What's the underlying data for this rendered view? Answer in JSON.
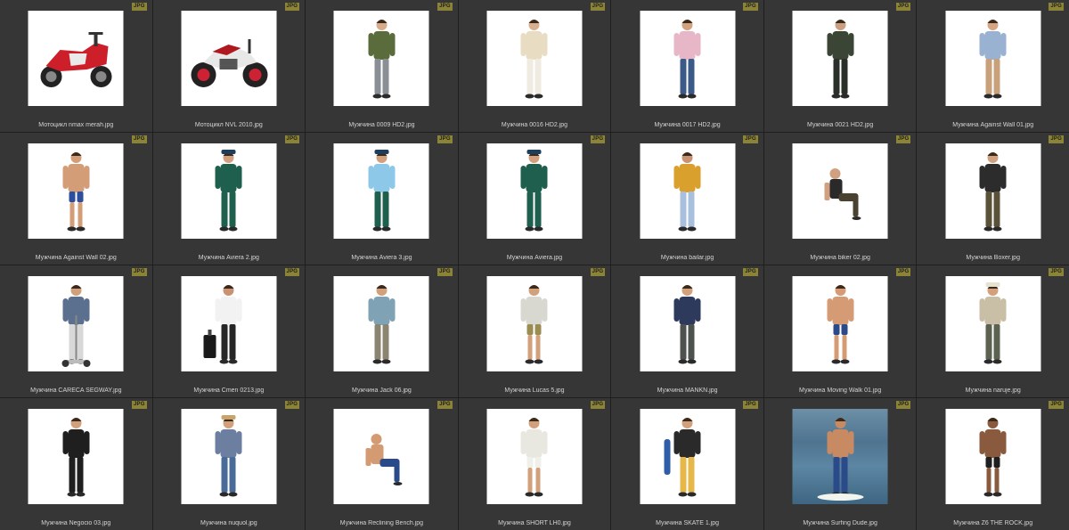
{
  "badge_label": "JPG",
  "colors": {
    "background": "#2b2b2b",
    "tile": "#363636",
    "badge": "#8b8336",
    "filename_text": "#d4d4d4"
  },
  "files": [
    {
      "name": "Мотоцикл nmax merah.jpg",
      "kind": "moto-scooter"
    },
    {
      "name": "Мотоцикл NVL 2010.jpg",
      "kind": "moto-sport"
    },
    {
      "name": "Мужчина 0009 HD2.jpg",
      "kind": "man-vest-wave"
    },
    {
      "name": "Мужчина 0016 HD2.jpg",
      "kind": "man-old-point"
    },
    {
      "name": "Мужчина 0017 HD2.jpg",
      "kind": "man-pink-shirt"
    },
    {
      "name": "Мужчина 0021 HD2.jpg",
      "kind": "man-blazer"
    },
    {
      "name": "Мужчина Against Wall 01.jpg",
      "kind": "man-lean-shirt"
    },
    {
      "name": "Мужчина Against Wall 02.jpg",
      "kind": "man-shirtless-lean"
    },
    {
      "name": "Мужчина Aviera 2.jpg",
      "kind": "man-uniform-cap"
    },
    {
      "name": "Мужчина Aviera 3.jpg",
      "kind": "man-uniform-blue"
    },
    {
      "name": "Мужчина Aviera.jpg",
      "kind": "man-uniform"
    },
    {
      "name": "Мужчина bailar.jpg",
      "kind": "man-dance"
    },
    {
      "name": "Мужчина biker 02.jpg",
      "kind": "man-sitting"
    },
    {
      "name": "Мужчина Boxer.jpg",
      "kind": "man-leather"
    },
    {
      "name": "Мужчина CARECA SEGWAY.jpg",
      "kind": "man-segway"
    },
    {
      "name": "Мужчина Cmen 0213.jpg",
      "kind": "man-luggage"
    },
    {
      "name": "Мужчина Jack 06.jpg",
      "kind": "man-casual"
    },
    {
      "name": "Мужчина Lucas 5.jpg",
      "kind": "man-shorts"
    },
    {
      "name": "Мужчина MANKN.jpg",
      "kind": "man-heavy"
    },
    {
      "name": "Мужчина Moving Walk 01.jpg",
      "kind": "man-walk-shirtless"
    },
    {
      "name": "Мужчина naruje.jpg",
      "kind": "man-jacket-hat"
    },
    {
      "name": "Мужчина Negocio 03.jpg",
      "kind": "man-suit"
    },
    {
      "name": "Мужчина nuquol.jpg",
      "kind": "man-cowboy"
    },
    {
      "name": "Мужчина Reclining Bench.jpg",
      "kind": "man-reclining"
    },
    {
      "name": "Мужчина SHORT LH0.jpg",
      "kind": "man-white-shorts"
    },
    {
      "name": "Мужчина SKATE 1.jpg",
      "kind": "man-skate"
    },
    {
      "name": "Мужчина Surfing Dude.jpg",
      "kind": "man-surf"
    },
    {
      "name": "Мужчина Z6 THE ROCK.jpg",
      "kind": "man-rock"
    }
  ]
}
